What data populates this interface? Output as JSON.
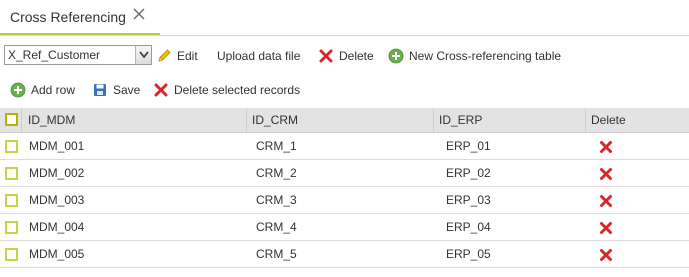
{
  "tab": {
    "label": "Cross Referencing"
  },
  "toolbar": {
    "table_select_value": "X_Ref_Customer",
    "edit_label": "Edit",
    "upload_label": "Upload data file",
    "delete_label": "Delete",
    "new_table_label": "New Cross-referencing table"
  },
  "row_toolbar": {
    "add_row_label": "Add row",
    "save_label": "Save",
    "delete_selected_label": "Delete selected records"
  },
  "grid": {
    "columns": [
      "ID_MDM",
      "ID_CRM",
      "ID_ERP",
      "Delete"
    ],
    "rows": [
      [
        "MDM_001",
        "CRM_1",
        "ERP_01"
      ],
      [
        "MDM_002",
        "CRM_2",
        "ERP_02"
      ],
      [
        "MDM_003",
        "CRM_3",
        "ERP_03"
      ],
      [
        "MDM_004",
        "CRM_4",
        "ERP_04"
      ],
      [
        "MDM_005",
        "CRM_5",
        "ERP_05"
      ]
    ]
  },
  "colors": {
    "accent": "#b6cf3a",
    "delete_red": "#d9262b",
    "add_green": "#6ab04c",
    "save_blue": "#3a72b8"
  },
  "icons": [
    "close-icon",
    "chevron-down-icon",
    "pencil-icon",
    "delete-x-icon",
    "add-circle-icon",
    "save-icon",
    "checkbox-icon"
  ]
}
